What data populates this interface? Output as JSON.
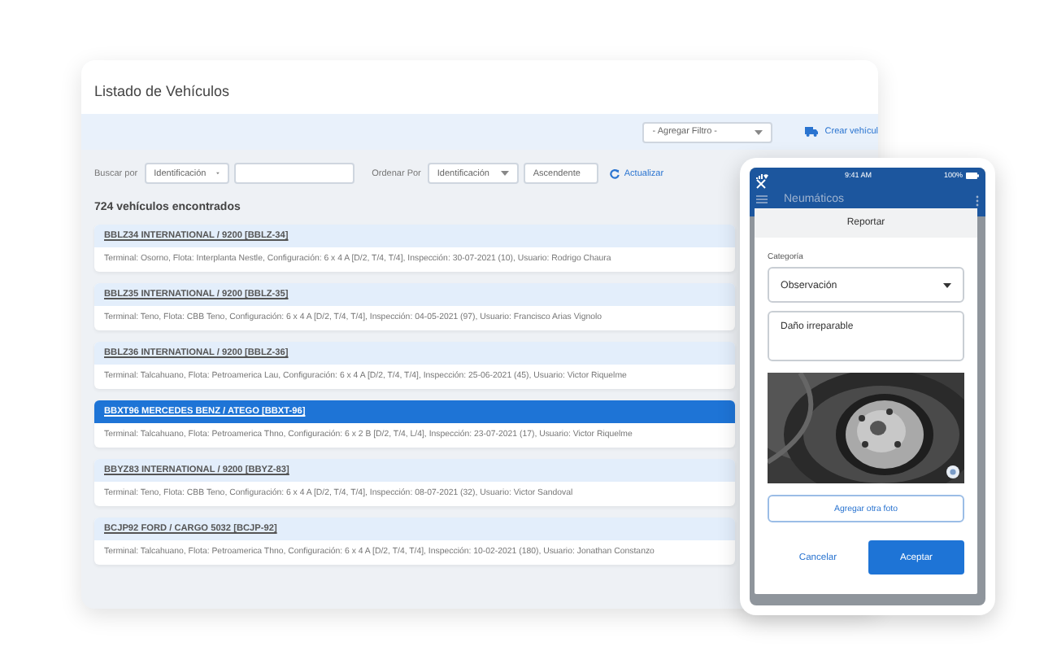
{
  "window": {
    "title": "Listado de Vehículos"
  },
  "toolbar": {
    "filter_select": "- Agregar Filtro -",
    "create_button": "Crear vehícul"
  },
  "search": {
    "search_by_label": "Buscar por",
    "search_by": "Identificación",
    "order_by_label": "Ordenar Por",
    "order_by": "Identificación",
    "direction": "Ascendente",
    "refresh": "Actualizar"
  },
  "result_count": "724 vehículos encontrados",
  "vehicles": [
    {
      "title": "BBLZ34 INTERNATIONAL / 9200 [BBLZ-34]",
      "details": "Terminal: Osorno, Flota: Interplanta Nestle, Configuración: 6 x 4 A [D/2, T/4, T/4], Inspección: 30-07-2021 (10), Usuario: Rodrigo Chaura",
      "selected": false
    },
    {
      "title": "BBLZ35 INTERNATIONAL / 9200 [BBLZ-35]",
      "details": "Terminal: Teno, Flota: CBB Teno, Configuración: 6 x 4 A [D/2, T/4, T/4], Inspección: 04-05-2021 (97), Usuario: Francisco Arias Vignolo",
      "selected": false
    },
    {
      "title": "BBLZ36 INTERNATIONAL / 9200 [BBLZ-36]",
      "details": "Terminal: Talcahuano, Flota: Petroamerica Lau, Configuración: 6 x 4 A [D/2, T/4, T/4], Inspección: 25-06-2021 (45), Usuario: Victor Riquelme",
      "selected": false
    },
    {
      "title": "BBXT96 MERCEDES BENZ / ATEGO [BBXT-96]",
      "details": "Terminal: Talcahuano, Flota: Petroamerica Thno, Configuración: 6 x 2 B [D/2, T/4, L/4], Inspección: 23-07-2021 (17), Usuario: Victor Riquelme",
      "selected": true
    },
    {
      "title": "BBYZ83 INTERNATIONAL / 9200 [BBYZ-83]",
      "details": "Terminal: Teno, Flota: CBB Teno, Configuración: 6 x 4 A [D/2, T/4, T/4], Inspección: 08-07-2021 (32), Usuario: Victor Sandoval",
      "selected": false
    },
    {
      "title": "BCJP92 FORD / CARGO 5032 [BCJP-92]",
      "details": "Terminal: Talcahuano, Flota: Petroamerica Thno, Configuración: 6 x 4 A [D/2, T/4, T/4], Inspección: 10-02-2021 (180), Usuario: Jonathan Constanzo",
      "selected": false
    }
  ],
  "phone": {
    "status_time": "9:41 AM",
    "battery": "100%",
    "app_title": "Neumáticos",
    "dialog": {
      "title": "Reportar",
      "category_label": "Categoría",
      "category": "Observación",
      "comment": "Daño irreparable",
      "add_photo": "Agregar otra foto",
      "cancel": "Cancelar",
      "accept": "Aceptar"
    }
  }
}
